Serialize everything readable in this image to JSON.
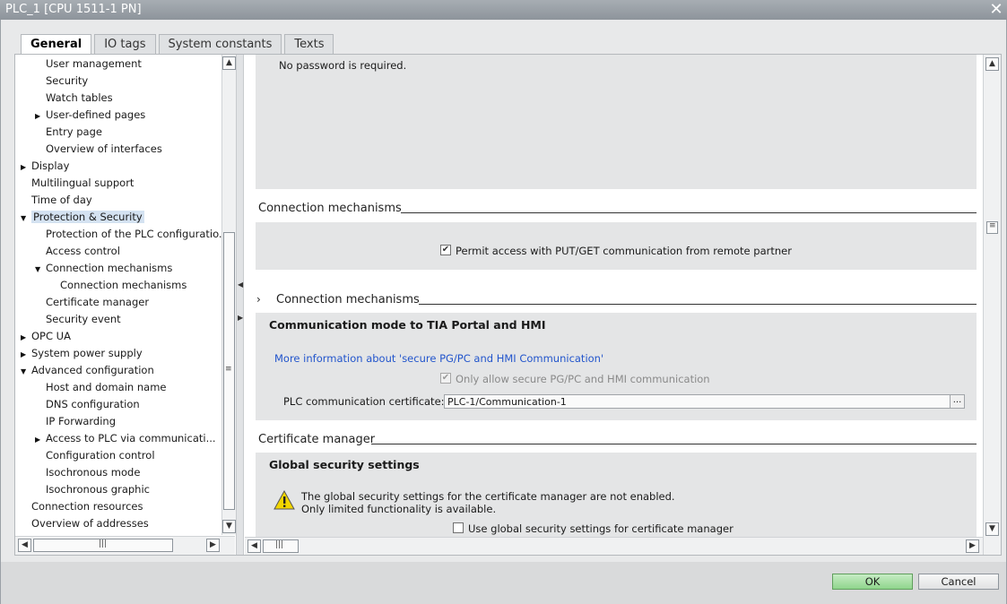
{
  "window": {
    "title": "PLC_1 [CPU 1511-1 PN]"
  },
  "tabs": [
    "General",
    "IO tags",
    "System constants",
    "Texts"
  ],
  "tree": [
    {
      "label": "User management",
      "indent": 1,
      "arrow": ""
    },
    {
      "label": "Security",
      "indent": 1,
      "arrow": ""
    },
    {
      "label": "Watch tables",
      "indent": 1,
      "arrow": ""
    },
    {
      "label": "User-defined pages",
      "indent": 1,
      "arrow": "right"
    },
    {
      "label": "Entry page",
      "indent": 1,
      "arrow": ""
    },
    {
      "label": "Overview of interfaces",
      "indent": 1,
      "arrow": ""
    },
    {
      "label": "Display",
      "indent": 0,
      "arrow": "right"
    },
    {
      "label": "Multilingual support",
      "indent": 0,
      "arrow": ""
    },
    {
      "label": "Time of day",
      "indent": 0,
      "arrow": ""
    },
    {
      "label": "Protection & Security",
      "indent": 0,
      "arrow": "down",
      "selected": true
    },
    {
      "label": "Protection of the PLC configuratio...",
      "indent": 1,
      "arrow": ""
    },
    {
      "label": "Access control",
      "indent": 1,
      "arrow": ""
    },
    {
      "label": "Connection mechanisms",
      "indent": 1,
      "arrow": "down"
    },
    {
      "label": "Connection mechanisms",
      "indent": 2,
      "arrow": ""
    },
    {
      "label": "Certificate manager",
      "indent": 1,
      "arrow": ""
    },
    {
      "label": "Security event",
      "indent": 1,
      "arrow": ""
    },
    {
      "label": "OPC UA",
      "indent": 0,
      "arrow": "right"
    },
    {
      "label": "System power supply",
      "indent": 0,
      "arrow": "right"
    },
    {
      "label": "Advanced configuration",
      "indent": 0,
      "arrow": "down"
    },
    {
      "label": "Host and domain name",
      "indent": 1,
      "arrow": ""
    },
    {
      "label": "DNS configuration",
      "indent": 1,
      "arrow": ""
    },
    {
      "label": "IP Forwarding",
      "indent": 1,
      "arrow": ""
    },
    {
      "label": "Access to PLC via communicati...",
      "indent": 1,
      "arrow": "right"
    },
    {
      "label": "Configuration control",
      "indent": 1,
      "arrow": ""
    },
    {
      "label": "Isochronous mode",
      "indent": 1,
      "arrow": ""
    },
    {
      "label": "Isochronous graphic",
      "indent": 1,
      "arrow": ""
    },
    {
      "label": "Connection resources",
      "indent": 0,
      "arrow": ""
    },
    {
      "label": "Overview of addresses",
      "indent": 0,
      "arrow": ""
    }
  ],
  "main": {
    "top_text": "No password is required.",
    "conn_section": "Connection mechanisms",
    "put_get_label": "Permit access with PUT/GET communication from remote partner",
    "put_get_checked": "✔",
    "conn_section2": "Connection mechanisms",
    "conn_expand": "›",
    "comm_mode_title": "Communication mode to TIA Portal and HMI",
    "more_info_link": "More information about 'secure PG/PC and HMI Communication'",
    "secure_only_label": "Only allow secure PG/PC and HMI communication",
    "secure_only_checked": "✔",
    "cert_label": "PLC communication certificate:",
    "cert_value": "PLC-1/Communication-1",
    "cert_browse": "...",
    "cert_section": "Certificate manager",
    "global_title": "Global security settings",
    "warn_line1": "The global security settings for the certificate manager are not enabled.",
    "warn_line2": "Only limited functionality is available.",
    "use_global_label": "Use global security settings for certificate manager",
    "use_global_checked": ""
  },
  "buttons": {
    "ok": "OK",
    "cancel": "Cancel"
  },
  "colors": {
    "ok_green": "#8fd58c",
    "link_blue": "#2255cc",
    "warning_yellow": "#f2d600"
  }
}
